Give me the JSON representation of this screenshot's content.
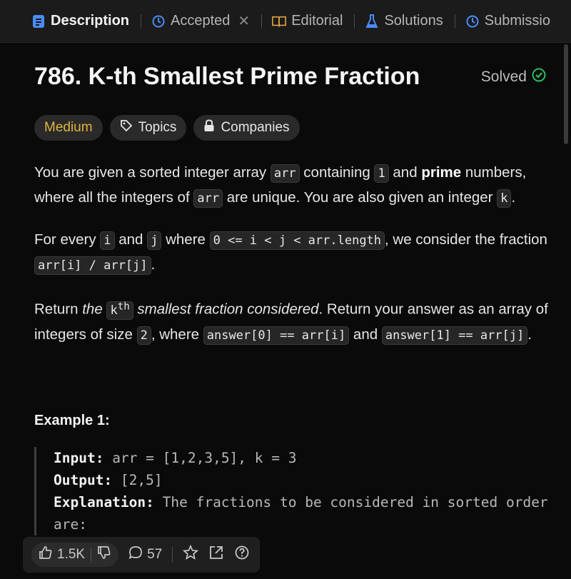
{
  "tabs": [
    {
      "label": "Description",
      "icon": "description-icon"
    },
    {
      "label": "Accepted",
      "icon": "history-icon"
    },
    {
      "label": "Editorial",
      "icon": "book-icon"
    },
    {
      "label": "Solutions",
      "icon": "flask-icon"
    },
    {
      "label": "Submissio",
      "icon": "history-icon"
    }
  ],
  "problem": {
    "title": "786. K-th Smallest Prime Fraction",
    "status": "Solved",
    "difficulty": "Medium",
    "topics_label": "Topics",
    "companies_label": "Companies"
  },
  "description": {
    "p1": {
      "a": "You are given a sorted integer array ",
      "code1": "arr",
      "b": " containing ",
      "code2": "1",
      "c": " and ",
      "bold": "prime",
      "d": " numbers, where all the integers of ",
      "code3": "arr",
      "e": " are unique. You are also given an integer ",
      "code4": "k",
      "f": "."
    },
    "p2": {
      "a": "For every ",
      "code1": "i",
      "b": " and ",
      "code2": "j",
      "c": " where ",
      "code3": "0 <= i < j < arr.length",
      "d": ", we consider the fraction ",
      "code4": "arr[i] / arr[j]",
      "e": "."
    },
    "p3": {
      "a": "Return ",
      "em1": "the ",
      "code_k": "k",
      "sup": "th",
      "em2": " smallest fraction considered",
      "b": ". Return your answer as an array of integers of size ",
      "code1": "2",
      "c": ", where ",
      "code2": "answer[0] == arr[i]",
      "d": " and ",
      "code3": "answer[1] == arr[j]",
      "e": "."
    }
  },
  "example": {
    "title": "Example 1:",
    "input_label": "Input:",
    "input_value": " arr = [1,2,3,5], k = 3",
    "output_label": "Output:",
    "output_value": " [2,5]",
    "explanation_label": "Explanation:",
    "explanation_value": " The fractions to be considered in sorted order are:"
  },
  "footer": {
    "likes": "1.5K",
    "comments": "57"
  },
  "colors": {
    "medium": "#e0b33c",
    "solved_check": "#2cbb5d",
    "accent_blue": "#4a8cf7"
  }
}
